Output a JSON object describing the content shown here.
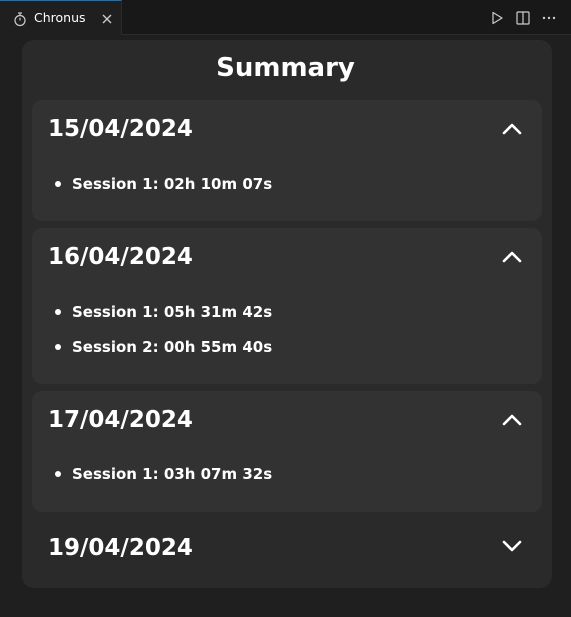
{
  "tab": {
    "label": "Chronus",
    "icon": "stopwatch-icon"
  },
  "toolbar": {
    "run_icon": "play-icon",
    "split_icon": "split-editor-icon",
    "more_icon": "more-actions-icon"
  },
  "summary": {
    "title": "Summary",
    "days": [
      {
        "date": "15/04/2024",
        "expanded": true,
        "sessions": [
          "Session 1: 02h 10m 07s"
        ]
      },
      {
        "date": "16/04/2024",
        "expanded": true,
        "sessions": [
          "Session 1: 05h 31m 42s",
          "Session 2: 00h 55m 40s"
        ]
      },
      {
        "date": "17/04/2024",
        "expanded": true,
        "sessions": [
          "Session 1: 03h 07m 32s"
        ]
      },
      {
        "date": "19/04/2024",
        "expanded": false,
        "sessions": []
      }
    ]
  },
  "colors": {
    "accent": "#0078d4",
    "panel": "#2a2a2a",
    "card": "#323232"
  }
}
